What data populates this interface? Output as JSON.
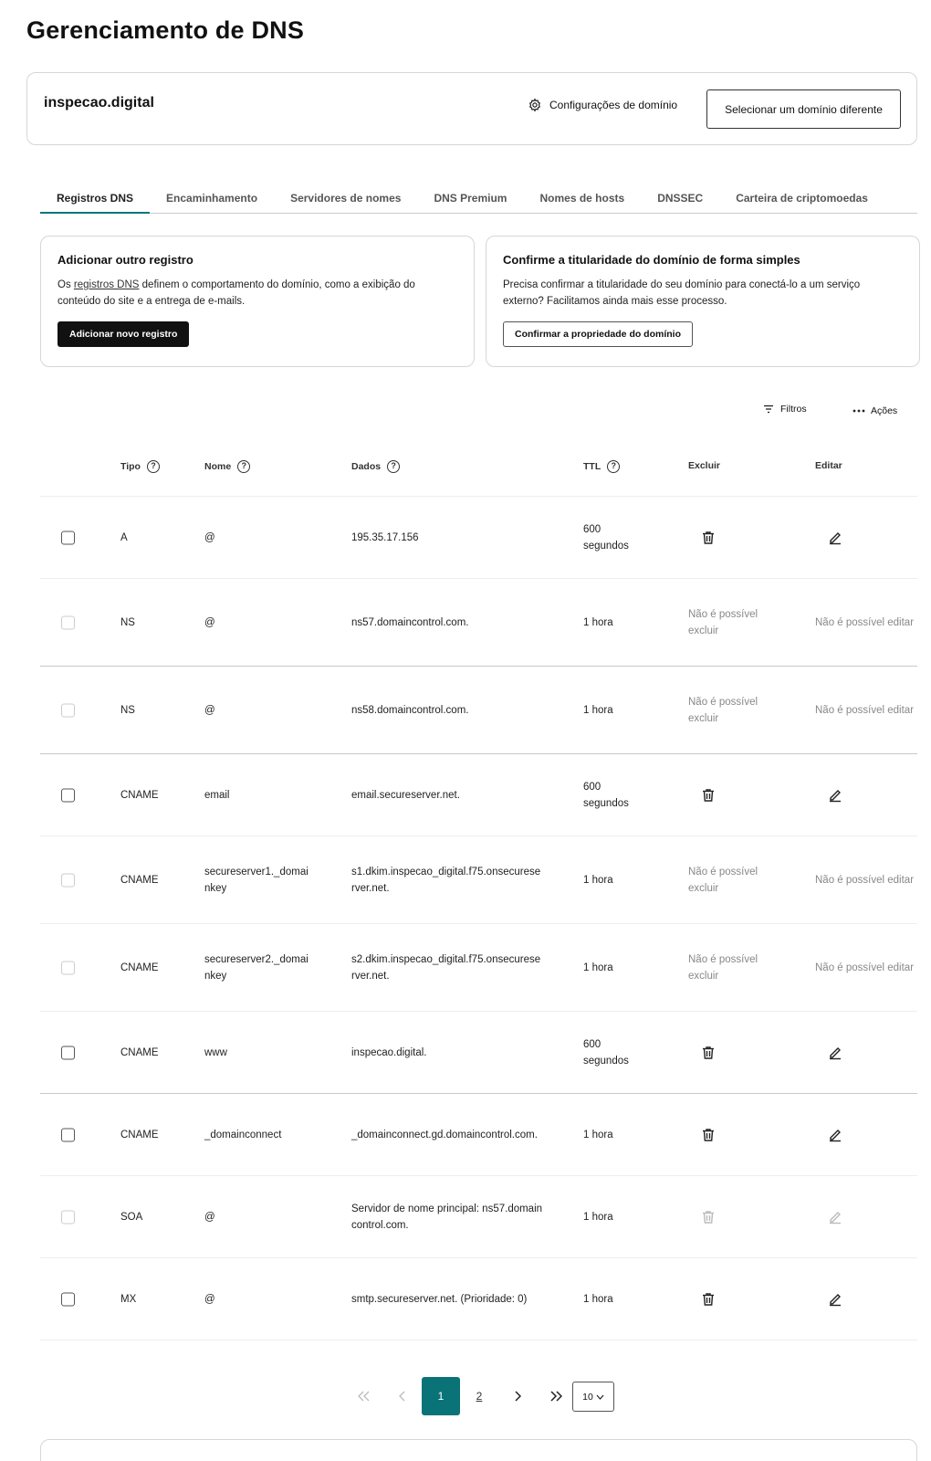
{
  "page": {
    "title": "Gerenciamento de DNS"
  },
  "domain": {
    "name": "inspecao.digital",
    "settings_label": "Configurações de domínio",
    "select_other_label": "Selecionar um domínio diferente"
  },
  "tabs": [
    {
      "label": "Registros DNS",
      "active": true
    },
    {
      "label": "Encaminhamento"
    },
    {
      "label": "Servidores de nomes"
    },
    {
      "label": "DNS Premium"
    },
    {
      "label": "Nomes de hosts"
    },
    {
      "label": "DNSSEC"
    },
    {
      "label": "Carteira de criptomoedas"
    }
  ],
  "add_record": {
    "title": "Adicionar outro registro",
    "text_before": "Os ",
    "link_text": "registros DNS",
    "text_after": " definem o comportamento do domínio, como a exibição do conteúdo do site e a entrega de e-mails.",
    "button": "Adicionar novo registro"
  },
  "confirm_ownership": {
    "title": "Confirme a titularidade do domínio de forma simples",
    "text": "Precisa confirmar a titularidade do seu domínio para conectá-lo a um serviço externo? Facilitamos ainda mais esse processo.",
    "button": "Confirmar a propriedade do domínio"
  },
  "toolbar": {
    "filters": "Filtros",
    "actions": "Ações"
  },
  "table": {
    "headers": {
      "type": "Tipo",
      "name": "Nome",
      "data": "Dados",
      "ttl": "TTL",
      "delete": "Excluir",
      "edit": "Editar"
    },
    "rows": [
      {
        "type": "A",
        "name": "@",
        "data": "195.35.17.156",
        "ttl": "600 segundos",
        "editable": true
      },
      {
        "type": "NS",
        "name": "@",
        "data": "ns57.domaincontrol.com.",
        "ttl": "1 hora",
        "editable": false,
        "no_delete": "Não é possível excluir",
        "no_edit": "Não é possível editar"
      },
      {
        "type": "NS",
        "name": "@",
        "data": "ns58.domaincontrol.com.",
        "ttl": "1 hora",
        "editable": false,
        "no_delete": "Não é possível excluir",
        "no_edit": "Não é possível editar"
      },
      {
        "type": "CNAME",
        "name": "email",
        "data": "email.secureserver.net.",
        "ttl": "600 segundos",
        "editable": true
      },
      {
        "type": "CNAME",
        "name": "secureserver1._domainkey",
        "data": "s1.dkim.inspecao_digital.f75.onsecureserver.net.",
        "ttl": "1 hora",
        "editable": false,
        "no_delete": "Não é possível excluir",
        "no_edit": "Não é possível editar"
      },
      {
        "type": "CNAME",
        "name": "secureserver2._domainkey",
        "data": "s2.dkim.inspecao_digital.f75.onsecureserver.net.",
        "ttl": "1 hora",
        "editable": false,
        "no_delete": "Não é possível excluir",
        "no_edit": "Não é possível editar"
      },
      {
        "type": "CNAME",
        "name": "www",
        "data": "inspecao.digital.",
        "ttl": "600 segundos",
        "editable": true
      },
      {
        "type": "CNAME",
        "name": "_domainconnect",
        "data": "_domainconnect.gd.domaincontrol.com.",
        "ttl": "1 hora",
        "editable": true
      },
      {
        "type": "SOA",
        "name": "@",
        "data": "Servidor de nome principal: ns57.domaincontrol.com.",
        "ttl": "1 hora",
        "editable": "disabled-icons"
      },
      {
        "type": "MX",
        "name": "@",
        "data": "smtp.secureserver.net. (Prioridade: 0)",
        "ttl": "1 hora",
        "editable": true
      }
    ]
  },
  "pagination": {
    "pages": [
      "1",
      "2"
    ],
    "current": "1",
    "per_page": "10"
  }
}
